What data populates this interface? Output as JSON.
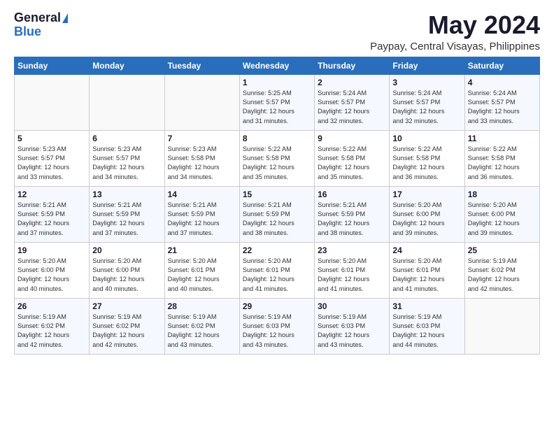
{
  "logo": {
    "general": "General",
    "blue": "Blue"
  },
  "title": {
    "month": "May 2024",
    "location": "Paypay, Central Visayas, Philippines"
  },
  "days_of_week": [
    "Sunday",
    "Monday",
    "Tuesday",
    "Wednesday",
    "Thursday",
    "Friday",
    "Saturday"
  ],
  "weeks": [
    [
      {
        "day": "",
        "info": ""
      },
      {
        "day": "",
        "info": ""
      },
      {
        "day": "",
        "info": ""
      },
      {
        "day": "1",
        "info": "Sunrise: 5:25 AM\nSunset: 5:57 PM\nDaylight: 12 hours\nand 31 minutes."
      },
      {
        "day": "2",
        "info": "Sunrise: 5:24 AM\nSunset: 5:57 PM\nDaylight: 12 hours\nand 32 minutes."
      },
      {
        "day": "3",
        "info": "Sunrise: 5:24 AM\nSunset: 5:57 PM\nDaylight: 12 hours\nand 32 minutes."
      },
      {
        "day": "4",
        "info": "Sunrise: 5:24 AM\nSunset: 5:57 PM\nDaylight: 12 hours\nand 33 minutes."
      }
    ],
    [
      {
        "day": "5",
        "info": "Sunrise: 5:23 AM\nSunset: 5:57 PM\nDaylight: 12 hours\nand 33 minutes."
      },
      {
        "day": "6",
        "info": "Sunrise: 5:23 AM\nSunset: 5:57 PM\nDaylight: 12 hours\nand 34 minutes."
      },
      {
        "day": "7",
        "info": "Sunrise: 5:23 AM\nSunset: 5:58 PM\nDaylight: 12 hours\nand 34 minutes."
      },
      {
        "day": "8",
        "info": "Sunrise: 5:22 AM\nSunset: 5:58 PM\nDaylight: 12 hours\nand 35 minutes."
      },
      {
        "day": "9",
        "info": "Sunrise: 5:22 AM\nSunset: 5:58 PM\nDaylight: 12 hours\nand 35 minutes."
      },
      {
        "day": "10",
        "info": "Sunrise: 5:22 AM\nSunset: 5:58 PM\nDaylight: 12 hours\nand 36 minutes."
      },
      {
        "day": "11",
        "info": "Sunrise: 5:22 AM\nSunset: 5:58 PM\nDaylight: 12 hours\nand 36 minutes."
      }
    ],
    [
      {
        "day": "12",
        "info": "Sunrise: 5:21 AM\nSunset: 5:59 PM\nDaylight: 12 hours\nand 37 minutes."
      },
      {
        "day": "13",
        "info": "Sunrise: 5:21 AM\nSunset: 5:59 PM\nDaylight: 12 hours\nand 37 minutes."
      },
      {
        "day": "14",
        "info": "Sunrise: 5:21 AM\nSunset: 5:59 PM\nDaylight: 12 hours\nand 37 minutes."
      },
      {
        "day": "15",
        "info": "Sunrise: 5:21 AM\nSunset: 5:59 PM\nDaylight: 12 hours\nand 38 minutes."
      },
      {
        "day": "16",
        "info": "Sunrise: 5:21 AM\nSunset: 5:59 PM\nDaylight: 12 hours\nand 38 minutes."
      },
      {
        "day": "17",
        "info": "Sunrise: 5:20 AM\nSunset: 6:00 PM\nDaylight: 12 hours\nand 39 minutes."
      },
      {
        "day": "18",
        "info": "Sunrise: 5:20 AM\nSunset: 6:00 PM\nDaylight: 12 hours\nand 39 minutes."
      }
    ],
    [
      {
        "day": "19",
        "info": "Sunrise: 5:20 AM\nSunset: 6:00 PM\nDaylight: 12 hours\nand 40 minutes."
      },
      {
        "day": "20",
        "info": "Sunrise: 5:20 AM\nSunset: 6:00 PM\nDaylight: 12 hours\nand 40 minutes."
      },
      {
        "day": "21",
        "info": "Sunrise: 5:20 AM\nSunset: 6:01 PM\nDaylight: 12 hours\nand 40 minutes."
      },
      {
        "day": "22",
        "info": "Sunrise: 5:20 AM\nSunset: 6:01 PM\nDaylight: 12 hours\nand 41 minutes."
      },
      {
        "day": "23",
        "info": "Sunrise: 5:20 AM\nSunset: 6:01 PM\nDaylight: 12 hours\nand 41 minutes."
      },
      {
        "day": "24",
        "info": "Sunrise: 5:20 AM\nSunset: 6:01 PM\nDaylight: 12 hours\nand 41 minutes."
      },
      {
        "day": "25",
        "info": "Sunrise: 5:19 AM\nSunset: 6:02 PM\nDaylight: 12 hours\nand 42 minutes."
      }
    ],
    [
      {
        "day": "26",
        "info": "Sunrise: 5:19 AM\nSunset: 6:02 PM\nDaylight: 12 hours\nand 42 minutes."
      },
      {
        "day": "27",
        "info": "Sunrise: 5:19 AM\nSunset: 6:02 PM\nDaylight: 12 hours\nand 42 minutes."
      },
      {
        "day": "28",
        "info": "Sunrise: 5:19 AM\nSunset: 6:02 PM\nDaylight: 12 hours\nand 43 minutes."
      },
      {
        "day": "29",
        "info": "Sunrise: 5:19 AM\nSunset: 6:03 PM\nDaylight: 12 hours\nand 43 minutes."
      },
      {
        "day": "30",
        "info": "Sunrise: 5:19 AM\nSunset: 6:03 PM\nDaylight: 12 hours\nand 43 minutes."
      },
      {
        "day": "31",
        "info": "Sunrise: 5:19 AM\nSunset: 6:03 PM\nDaylight: 12 hours\nand 44 minutes."
      },
      {
        "day": "",
        "info": ""
      }
    ]
  ]
}
